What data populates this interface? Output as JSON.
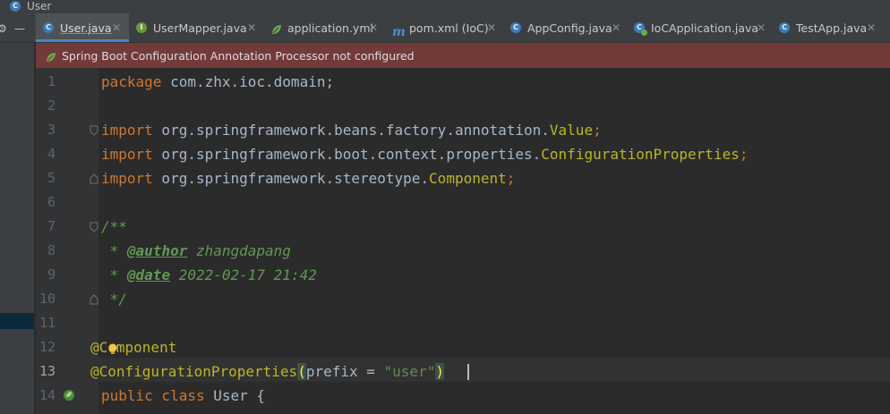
{
  "breadcrumb": {
    "item": "User"
  },
  "tabs": [
    {
      "label": "User.java",
      "icon": "class-icon",
      "active": true
    },
    {
      "label": "UserMapper.java",
      "icon": "interface-icon"
    },
    {
      "label": "application.yml",
      "icon": "spring-yml-icon"
    },
    {
      "label": "pom.xml (IoC)",
      "icon": "maven-icon"
    },
    {
      "label": "AppConfig.java",
      "icon": "class-icon"
    },
    {
      "label": "IoCApplication.java",
      "icon": "spring-boot-class-icon"
    },
    {
      "label": "TestApp.java",
      "icon": "class-icon"
    }
  ],
  "toolbar": {
    "settings_glyph": "⚙",
    "hide_glyph": "—"
  },
  "notification": {
    "text": "Spring Boot Configuration Annotation Processor not configured"
  },
  "editor": {
    "lines": [
      {
        "num": "1"
      },
      {
        "num": "2"
      },
      {
        "num": "3"
      },
      {
        "num": "4"
      },
      {
        "num": "5"
      },
      {
        "num": "6"
      },
      {
        "num": "7"
      },
      {
        "num": "8"
      },
      {
        "num": "9"
      },
      {
        "num": "10"
      },
      {
        "num": "11"
      },
      {
        "num": "12"
      },
      {
        "num": "13"
      },
      {
        "num": "14"
      }
    ],
    "tokens": {
      "package_kw": "package",
      "package_name": " com.zhx.ioc.domain;",
      "import_kw": "import",
      "imp1_path": " org.springframework.beans.factory.annotation.",
      "imp1_cls": "Value",
      "semi": ";",
      "imp2_path": " org.springframework.boot.context.properties.",
      "imp2_cls": "ConfigurationProperties",
      "imp3_path": " org.springframework.stereotype.",
      "imp3_cls": "Component",
      "doc_open": "/**",
      "doc_star": " * ",
      "author_tag": "@author",
      "author_val": " zhangdapang",
      "date_tag": "@date",
      "date_val": " 2022-02-17 21:42",
      "doc_close": " */",
      "ann_component": "@Component",
      "ann_cfg": "@ConfigurationProperties",
      "lparen": "(",
      "prefix_attr": "prefix = ",
      "prefix_val": "\"user\"",
      "rparen": ")",
      "public_kw": "public",
      "class_kw": " class",
      "class_name": " User {"
    }
  },
  "colors": {
    "background": "#2b2b2b",
    "keyword": "#cc7832",
    "annotation": "#bbb529",
    "string": "#6a8759",
    "comment": "#629755",
    "notification_bg": "#733a3a",
    "active_tab_underline": "#4a88c7"
  }
}
